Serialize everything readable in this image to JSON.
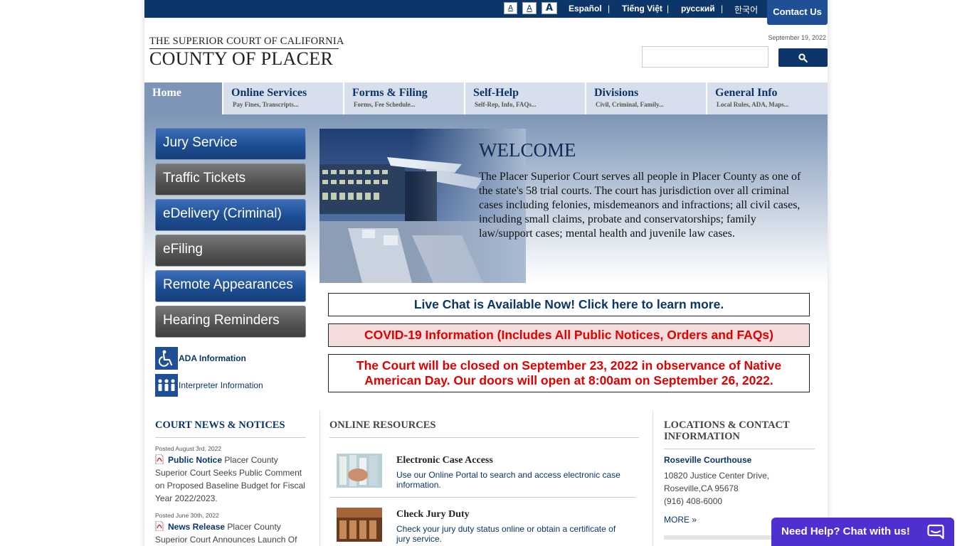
{
  "topbar": {
    "font_sizes": [
      "A",
      "A",
      "A"
    ],
    "languages": [
      "Español",
      "Tiếng Việt",
      "русский",
      "한국어"
    ],
    "separator": "|",
    "contact_label": "Contact Us"
  },
  "logo": {
    "line1": "THE SUPERIOR COURT OF CALIFORNIA",
    "line2": "COUNTY OF PLACER"
  },
  "header": {
    "date": "September 19, 2022",
    "search_placeholder": ""
  },
  "nav": [
    {
      "title": "Home",
      "sub": ""
    },
    {
      "title": "Online Services",
      "sub": "Pay Fines, Transcripts..."
    },
    {
      "title": "Forms & Filing",
      "sub": "Forms, Fee Schedule..."
    },
    {
      "title": "Self-Help",
      "sub": "Self-Rep, Info, FAQs..."
    },
    {
      "title": "Divisions",
      "sub": "Civil, Criminal, Family..."
    },
    {
      "title": "General Info",
      "sub": "Local Rules, ADA, Maps..."
    }
  ],
  "quick_links": [
    "Jury Service",
    "Traffic Tickets",
    "eDelivery (Criminal)",
    "eFiling",
    "Remote Appearances",
    "Hearing Reminders"
  ],
  "info_links": {
    "ada": "ADA Information",
    "interpreter": "Interpreter Information"
  },
  "hero": {
    "title": "WELCOME",
    "text": "The Placer Superior Court serves all people in Placer County as one of the state's 58 trial courts. The court has jurisdiction over all criminal cases including felonies, misdemeanors and infractions; all civil cases, including small claims, probate and conservatorships; family law/support cases; mental health and juvenile law cases."
  },
  "notices": {
    "chat": "Live Chat is Available Now! Click here to learn more.",
    "covid": "COVID-19 Information (Includes All Public Notices, Orders and FAQs)",
    "closed": "The Court will be closed on September 23, 2022 in observance of Native American Day. Our doors will open at 8:00am on September 26, 2022."
  },
  "news": {
    "heading": "COURT NEWS & NOTICES",
    "items": [
      {
        "date": "Posted August 3rd, 2022",
        "label": "Public Notice",
        "text": "Placer County Superior Court Seeks Public Comment on Proposed Baseline Budget for Fiscal Year 2022/2023."
      },
      {
        "date": "Posted June 30th, 2022",
        "label": "News Release",
        "text": "Placer County Superior Court Announces Launch Of"
      }
    ]
  },
  "resources": {
    "heading": "ONLINE RESOURCES",
    "items": [
      {
        "title": "Electronic Case Access",
        "desc": "Use our Online Portal to search and access electronic case information."
      },
      {
        "title": "Check Jury Duty",
        "desc": "Check your jury duty status online or obtain a certificate of jury service."
      }
    ]
  },
  "locations": {
    "heading_line1": "LOCATIONS & CONTACT",
    "heading_line2": "INFORMATION",
    "name": "Roseville Courthouse",
    "address1": "10820 Justice Center Drive,",
    "address2": "Roseville,CA 95678",
    "phone": "(916) 408-6000",
    "more": "MORE »"
  },
  "chat_widget": {
    "label": "Need Help? Chat with us!"
  },
  "colors": {
    "navy": "#0c3569",
    "alert_red": "#e00000",
    "chat_purple": "#4f2fd0"
  }
}
